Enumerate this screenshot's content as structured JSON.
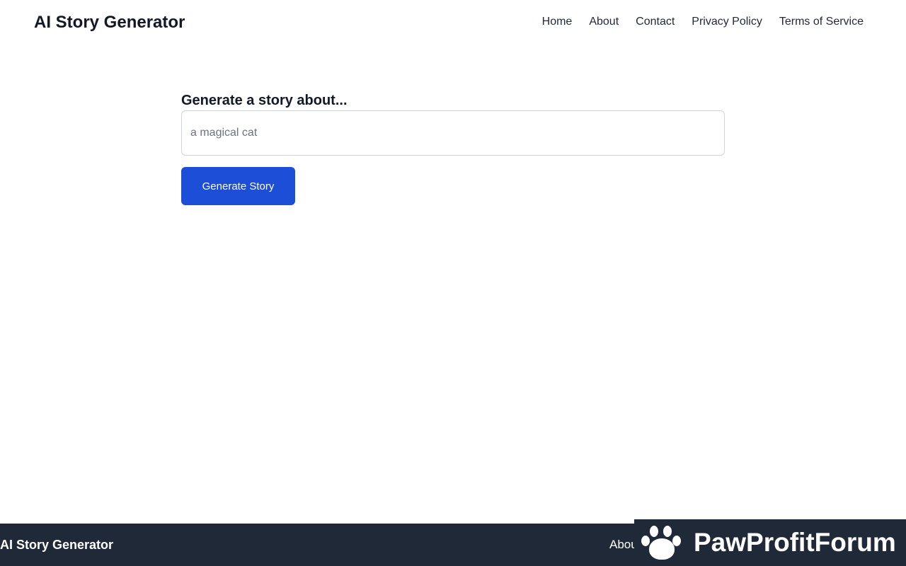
{
  "header": {
    "brand": "AI Story Generator",
    "nav": [
      {
        "label": "Home"
      },
      {
        "label": "About"
      },
      {
        "label": "Contact"
      },
      {
        "label": "Privacy Policy"
      },
      {
        "label": "Terms of Service"
      }
    ]
  },
  "form": {
    "label": "Generate a story about...",
    "input_value": "",
    "input_placeholder": "a magical cat",
    "button_label": "Generate Story"
  },
  "footer": {
    "brand": "AI Story Generator",
    "link_partial": "About"
  },
  "watermark": {
    "text": "PawProfitForum",
    "icon": "paw-icon"
  },
  "colors": {
    "primary_button": "#1d4ed8",
    "footer_bg": "#1f2937",
    "text": "#111827"
  }
}
